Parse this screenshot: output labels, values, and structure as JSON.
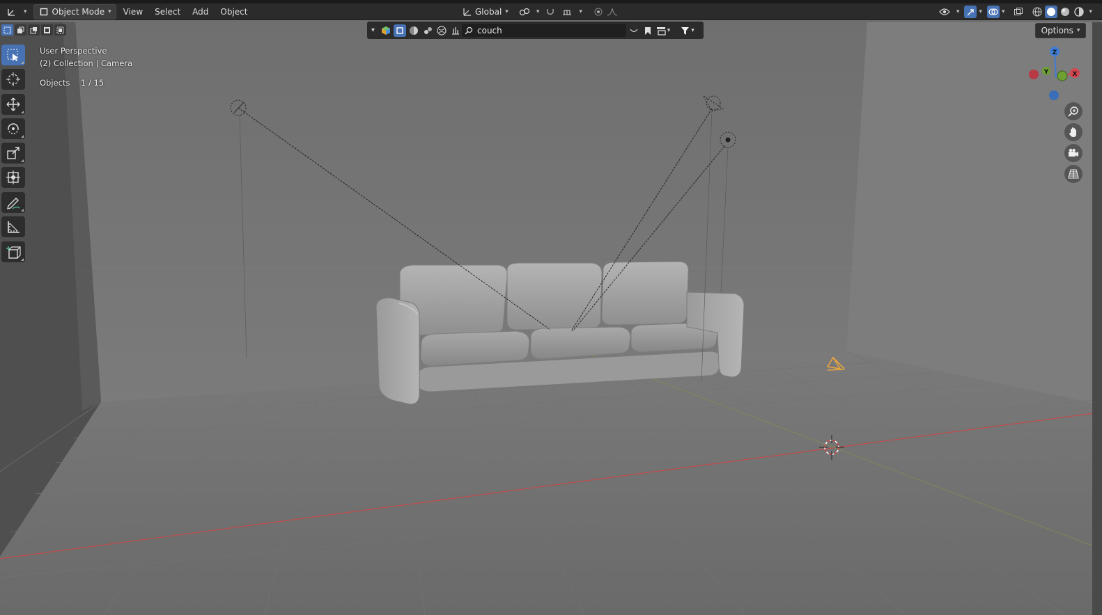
{
  "header": {
    "mode": "Object Mode",
    "menus": [
      "View",
      "Select",
      "Add",
      "Object"
    ],
    "transform_orientation": "Global"
  },
  "search": {
    "value": "couch"
  },
  "options_label": "Options",
  "overlay": {
    "view_name": "User Perspective",
    "collection_line": "(2) Collection | Camera",
    "objects_label": "Objects",
    "objects_count": "1 / 15"
  },
  "gizmo": {
    "x_label": "X",
    "y_label": "Y",
    "z_label": "Z"
  },
  "icons": {
    "editor_type": "3d-viewport-icon",
    "tools": [
      "select-box-icon",
      "cursor-icon",
      "move-icon",
      "rotate-icon",
      "scale-icon",
      "transform-icon",
      "annotate-icon",
      "measure-icon",
      "add-cube-icon"
    ],
    "nav": [
      "zoom-icon",
      "pan-hand-icon",
      "camera-view-icon",
      "ortho-grid-icon"
    ]
  },
  "colors": {
    "accent": "#4772b3",
    "axis_x": "#d6454f",
    "axis_y": "#6ea034",
    "axis_z": "#3e7dd6",
    "camera": "#e8a540"
  }
}
